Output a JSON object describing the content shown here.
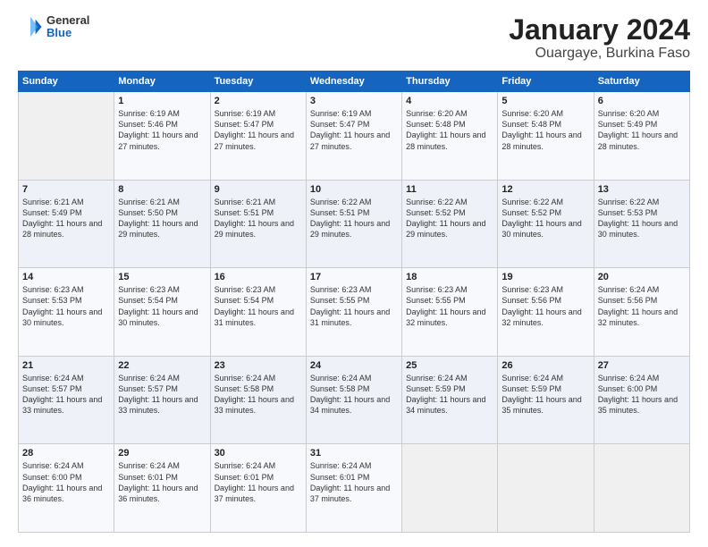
{
  "logo": {
    "general": "General",
    "blue": "Blue"
  },
  "header": {
    "title": "January 2024",
    "subtitle": "Ouargaye, Burkina Faso"
  },
  "columns": [
    "Sunday",
    "Monday",
    "Tuesday",
    "Wednesday",
    "Thursday",
    "Friday",
    "Saturday"
  ],
  "weeks": [
    [
      {
        "day": "",
        "sunrise": "",
        "sunset": "",
        "daylight": ""
      },
      {
        "day": "1",
        "sunrise": "Sunrise: 6:19 AM",
        "sunset": "Sunset: 5:46 PM",
        "daylight": "Daylight: 11 hours and 27 minutes."
      },
      {
        "day": "2",
        "sunrise": "Sunrise: 6:19 AM",
        "sunset": "Sunset: 5:47 PM",
        "daylight": "Daylight: 11 hours and 27 minutes."
      },
      {
        "day": "3",
        "sunrise": "Sunrise: 6:19 AM",
        "sunset": "Sunset: 5:47 PM",
        "daylight": "Daylight: 11 hours and 27 minutes."
      },
      {
        "day": "4",
        "sunrise": "Sunrise: 6:20 AM",
        "sunset": "Sunset: 5:48 PM",
        "daylight": "Daylight: 11 hours and 28 minutes."
      },
      {
        "day": "5",
        "sunrise": "Sunrise: 6:20 AM",
        "sunset": "Sunset: 5:48 PM",
        "daylight": "Daylight: 11 hours and 28 minutes."
      },
      {
        "day": "6",
        "sunrise": "Sunrise: 6:20 AM",
        "sunset": "Sunset: 5:49 PM",
        "daylight": "Daylight: 11 hours and 28 minutes."
      }
    ],
    [
      {
        "day": "7",
        "sunrise": "Sunrise: 6:21 AM",
        "sunset": "Sunset: 5:49 PM",
        "daylight": "Daylight: 11 hours and 28 minutes."
      },
      {
        "day": "8",
        "sunrise": "Sunrise: 6:21 AM",
        "sunset": "Sunset: 5:50 PM",
        "daylight": "Daylight: 11 hours and 29 minutes."
      },
      {
        "day": "9",
        "sunrise": "Sunrise: 6:21 AM",
        "sunset": "Sunset: 5:51 PM",
        "daylight": "Daylight: 11 hours and 29 minutes."
      },
      {
        "day": "10",
        "sunrise": "Sunrise: 6:22 AM",
        "sunset": "Sunset: 5:51 PM",
        "daylight": "Daylight: 11 hours and 29 minutes."
      },
      {
        "day": "11",
        "sunrise": "Sunrise: 6:22 AM",
        "sunset": "Sunset: 5:52 PM",
        "daylight": "Daylight: 11 hours and 29 minutes."
      },
      {
        "day": "12",
        "sunrise": "Sunrise: 6:22 AM",
        "sunset": "Sunset: 5:52 PM",
        "daylight": "Daylight: 11 hours and 30 minutes."
      },
      {
        "day": "13",
        "sunrise": "Sunrise: 6:22 AM",
        "sunset": "Sunset: 5:53 PM",
        "daylight": "Daylight: 11 hours and 30 minutes."
      }
    ],
    [
      {
        "day": "14",
        "sunrise": "Sunrise: 6:23 AM",
        "sunset": "Sunset: 5:53 PM",
        "daylight": "Daylight: 11 hours and 30 minutes."
      },
      {
        "day": "15",
        "sunrise": "Sunrise: 6:23 AM",
        "sunset": "Sunset: 5:54 PM",
        "daylight": "Daylight: 11 hours and 30 minutes."
      },
      {
        "day": "16",
        "sunrise": "Sunrise: 6:23 AM",
        "sunset": "Sunset: 5:54 PM",
        "daylight": "Daylight: 11 hours and 31 minutes."
      },
      {
        "day": "17",
        "sunrise": "Sunrise: 6:23 AM",
        "sunset": "Sunset: 5:55 PM",
        "daylight": "Daylight: 11 hours and 31 minutes."
      },
      {
        "day": "18",
        "sunrise": "Sunrise: 6:23 AM",
        "sunset": "Sunset: 5:55 PM",
        "daylight": "Daylight: 11 hours and 32 minutes."
      },
      {
        "day": "19",
        "sunrise": "Sunrise: 6:23 AM",
        "sunset": "Sunset: 5:56 PM",
        "daylight": "Daylight: 11 hours and 32 minutes."
      },
      {
        "day": "20",
        "sunrise": "Sunrise: 6:24 AM",
        "sunset": "Sunset: 5:56 PM",
        "daylight": "Daylight: 11 hours and 32 minutes."
      }
    ],
    [
      {
        "day": "21",
        "sunrise": "Sunrise: 6:24 AM",
        "sunset": "Sunset: 5:57 PM",
        "daylight": "Daylight: 11 hours and 33 minutes."
      },
      {
        "day": "22",
        "sunrise": "Sunrise: 6:24 AM",
        "sunset": "Sunset: 5:57 PM",
        "daylight": "Daylight: 11 hours and 33 minutes."
      },
      {
        "day": "23",
        "sunrise": "Sunrise: 6:24 AM",
        "sunset": "Sunset: 5:58 PM",
        "daylight": "Daylight: 11 hours and 33 minutes."
      },
      {
        "day": "24",
        "sunrise": "Sunrise: 6:24 AM",
        "sunset": "Sunset: 5:58 PM",
        "daylight": "Daylight: 11 hours and 34 minutes."
      },
      {
        "day": "25",
        "sunrise": "Sunrise: 6:24 AM",
        "sunset": "Sunset: 5:59 PM",
        "daylight": "Daylight: 11 hours and 34 minutes."
      },
      {
        "day": "26",
        "sunrise": "Sunrise: 6:24 AM",
        "sunset": "Sunset: 5:59 PM",
        "daylight": "Daylight: 11 hours and 35 minutes."
      },
      {
        "day": "27",
        "sunrise": "Sunrise: 6:24 AM",
        "sunset": "Sunset: 6:00 PM",
        "daylight": "Daylight: 11 hours and 35 minutes."
      }
    ],
    [
      {
        "day": "28",
        "sunrise": "Sunrise: 6:24 AM",
        "sunset": "Sunset: 6:00 PM",
        "daylight": "Daylight: 11 hours and 36 minutes."
      },
      {
        "day": "29",
        "sunrise": "Sunrise: 6:24 AM",
        "sunset": "Sunset: 6:01 PM",
        "daylight": "Daylight: 11 hours and 36 minutes."
      },
      {
        "day": "30",
        "sunrise": "Sunrise: 6:24 AM",
        "sunset": "Sunset: 6:01 PM",
        "daylight": "Daylight: 11 hours and 37 minutes."
      },
      {
        "day": "31",
        "sunrise": "Sunrise: 6:24 AM",
        "sunset": "Sunset: 6:01 PM",
        "daylight": "Daylight: 11 hours and 37 minutes."
      },
      {
        "day": "",
        "sunrise": "",
        "sunset": "",
        "daylight": ""
      },
      {
        "day": "",
        "sunrise": "",
        "sunset": "",
        "daylight": ""
      },
      {
        "day": "",
        "sunrise": "",
        "sunset": "",
        "daylight": ""
      }
    ]
  ]
}
